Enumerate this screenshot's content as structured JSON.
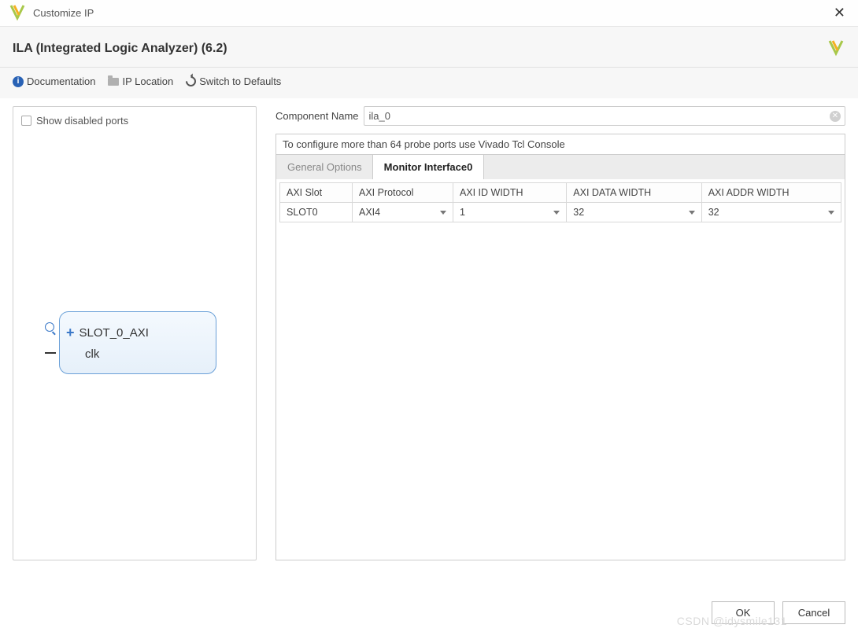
{
  "titlebar": {
    "title": "Customize IP"
  },
  "header": {
    "title": "ILA (Integrated Logic Analyzer) (6.2)"
  },
  "toolbar": {
    "documentation": "Documentation",
    "ip_location": "IP Location",
    "switch_defaults": "Switch to Defaults"
  },
  "left_panel": {
    "show_disabled_label": "Show disabled ports",
    "show_disabled_checked": false,
    "block": {
      "port1": "SLOT_0_AXI",
      "port2": "clk"
    }
  },
  "component": {
    "name_label": "Component Name",
    "name_value": "ila_0"
  },
  "info_bar": "To configure more than 64 probe ports use Vivado Tcl Console",
  "tabs": [
    {
      "label": "General Options",
      "active": false
    },
    {
      "label": "Monitor Interface0",
      "active": true
    }
  ],
  "table": {
    "headers": [
      "AXI Slot",
      "AXI Protocol",
      "AXI ID WIDTH",
      "AXI DATA WIDTH",
      "AXI ADDR WIDTH"
    ],
    "row": {
      "slot": "SLOT0",
      "protocol": "AXI4",
      "id_width": "1",
      "data_width": "32",
      "addr_width": "32"
    }
  },
  "footer": {
    "ok": "OK",
    "cancel": "Cancel"
  },
  "watermark": "CSDN @idysmile131"
}
